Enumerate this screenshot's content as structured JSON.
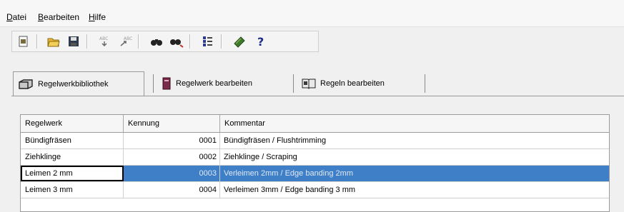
{
  "menu": {
    "items": [
      {
        "underline": "D",
        "rest": "atei"
      },
      {
        "underline": "B",
        "rest": "earbeiten"
      },
      {
        "underline": "H",
        "rest": "ilfe"
      }
    ]
  },
  "toolbar": {
    "icons": [
      "new-document-icon",
      "open-folder-icon",
      "save-icon",
      "import-icon",
      "export-icon",
      "find-icon",
      "find-next-icon",
      "list-settings-icon",
      "rules-icon",
      "help-icon"
    ]
  },
  "tabs": [
    {
      "label": "Regelwerkbibliothek",
      "icon": "library-icon"
    },
    {
      "label": "Regelwerk bearbeiten",
      "icon": "edit-ruleset-icon"
    },
    {
      "label": "Regeln bearbeiten",
      "icon": "edit-rules-icon"
    }
  ],
  "table": {
    "headers": [
      "Regelwerk",
      "Kennung",
      "Kommentar"
    ],
    "rows": [
      [
        "Bündigfräsen",
        "0001",
        "Bündigfräsen / Flushtrimming"
      ],
      [
        "Ziehklinge",
        "0002",
        "Ziehklinge / Scraping"
      ],
      [
        "Leimen 2 mm",
        "0003",
        "Verleimen 2mm  / Edge banding 2mm"
      ],
      [
        "Leimen 3 mm",
        "0004",
        "Verleimen 3mm  / Edge banding 3 mm"
      ]
    ],
    "selected_row": 2
  },
  "colors": {
    "selection": "#3f7fc7",
    "background": "#f0f0f0"
  }
}
